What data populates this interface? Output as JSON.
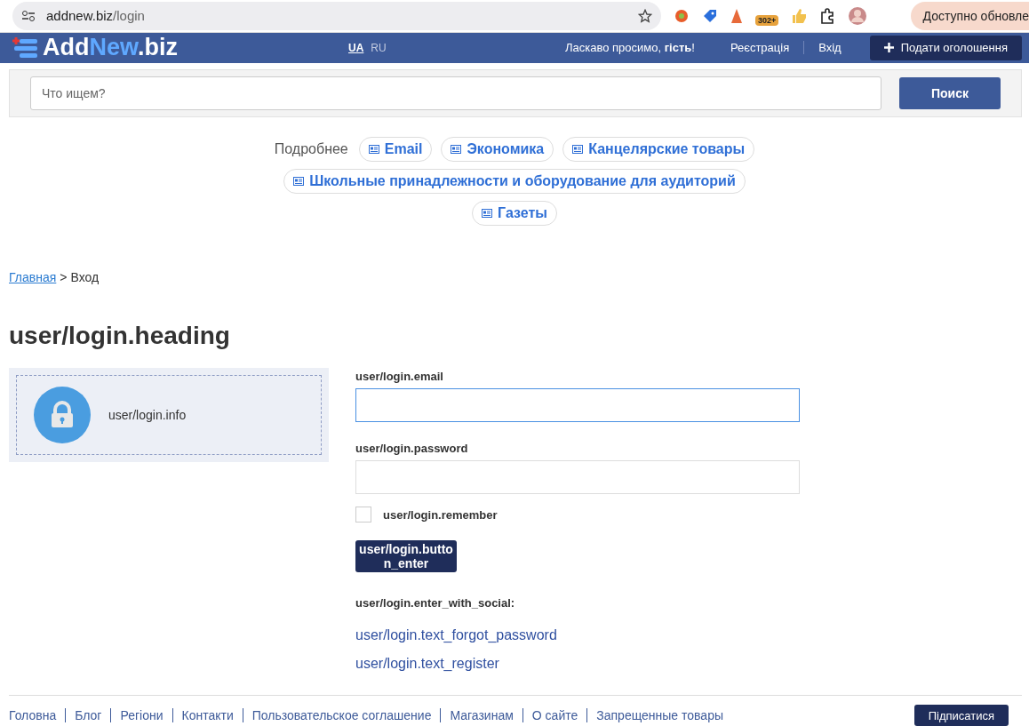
{
  "browser": {
    "url_host": "addnew.biz",
    "url_path": "/login",
    "extension_badge": "302+",
    "update_button": "Доступно обновле"
  },
  "header": {
    "logo_left": "Add",
    "logo_accent": "New",
    "logo_right": ".biz",
    "languages": [
      {
        "label": "UA",
        "selected": true
      },
      {
        "label": "RU",
        "selected": false
      }
    ],
    "welcome": "Ласкаво просимо, **гість**!",
    "links": [
      "Реєстрація",
      "Вхід"
    ],
    "post_button": "Подати оголошення"
  },
  "search": {
    "placeholder": "Что ищем?",
    "button": "Поиск"
  },
  "related": {
    "label": "Подробнее",
    "tags": [
      "Email",
      "Экономика",
      "Канцелярские товары",
      "Школьные принадлежности и оборудование для аудиторий",
      "Газеты"
    ]
  },
  "breadcrumb": {
    "home": "Главная",
    "separator": ">",
    "current": "Вход"
  },
  "heading": "user/login.heading",
  "info": "user/login.info",
  "form": {
    "fields": [
      {
        "label": "user/login.email",
        "focused": true
      },
      {
        "label": "user/login.password",
        "focused": false
      }
    ],
    "remember": {
      "label": "user/login.remember",
      "checked": false
    },
    "submit": "user/login.button_enter",
    "social": "user/login.enter_with_social:",
    "links": [
      "user/login.text_forgot_password",
      "user/login.text_register"
    ]
  },
  "footer": {
    "links": [
      "Головна",
      "Блог",
      "Регіони",
      "Контакти",
      "Пользовательское соглашение",
      "Магазинам",
      "О сайте",
      "Запрещенные товары"
    ],
    "subscribe": "Підписатися"
  }
}
